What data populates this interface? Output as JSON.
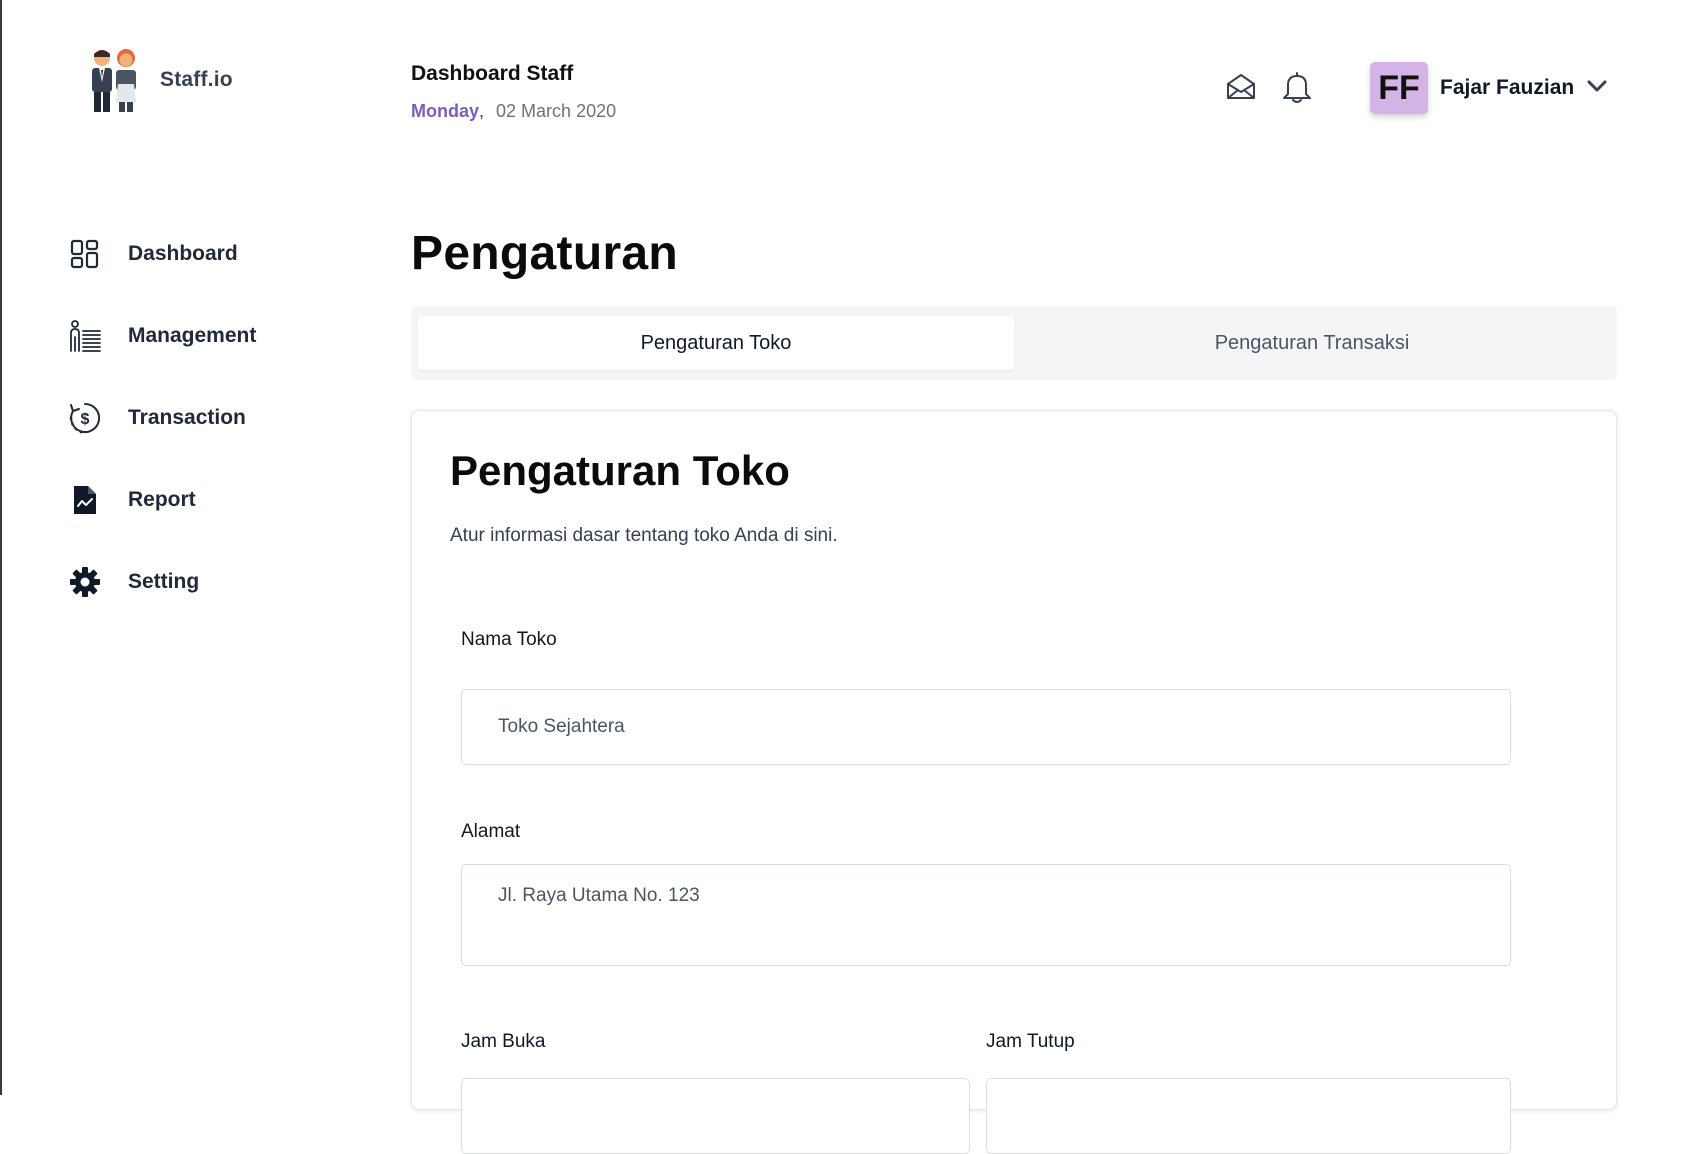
{
  "brand": {
    "name": "Staff.io"
  },
  "header": {
    "title": "Dashboard Staff",
    "day": "Monday",
    "date": "02 March 2020"
  },
  "icons": {
    "mail": "mail-open-icon",
    "bell": "bell-icon",
    "chevron": "chevron-down-icon"
  },
  "user": {
    "initials": "FF",
    "name": "Fajar Fauzian",
    "avatar_color": "#d4b4e6"
  },
  "sidebar": {
    "items": [
      {
        "label": "Dashboard",
        "icon": "grid-icon"
      },
      {
        "label": "Management",
        "icon": "management-icon"
      },
      {
        "label": "Transaction",
        "icon": "dollar-history-icon"
      },
      {
        "label": "Report",
        "icon": "report-icon"
      },
      {
        "label": "Setting",
        "icon": "gear-icon"
      }
    ]
  },
  "main": {
    "page_title": "Pengaturan",
    "tabs": [
      {
        "label": "Pengaturan Toko",
        "active": true
      },
      {
        "label": "Pengaturan Transaksi",
        "active": false
      }
    ],
    "card": {
      "title": "Pengaturan Toko",
      "description": "Atur informasi dasar tentang toko Anda di sini.",
      "fields": {
        "nama_toko": {
          "label": "Nama Toko",
          "value": "Toko Sejahtera"
        },
        "alamat": {
          "label": "Alamat",
          "value": "Jl. Raya Utama No. 123"
        },
        "jam_buka": {
          "label": "Jam Buka",
          "value": ""
        },
        "jam_tutup": {
          "label": "Jam Tutup",
          "value": ""
        }
      }
    }
  },
  "colors": {
    "accent": "#7c5cbf",
    "tab_bg": "#f4f5f7"
  }
}
